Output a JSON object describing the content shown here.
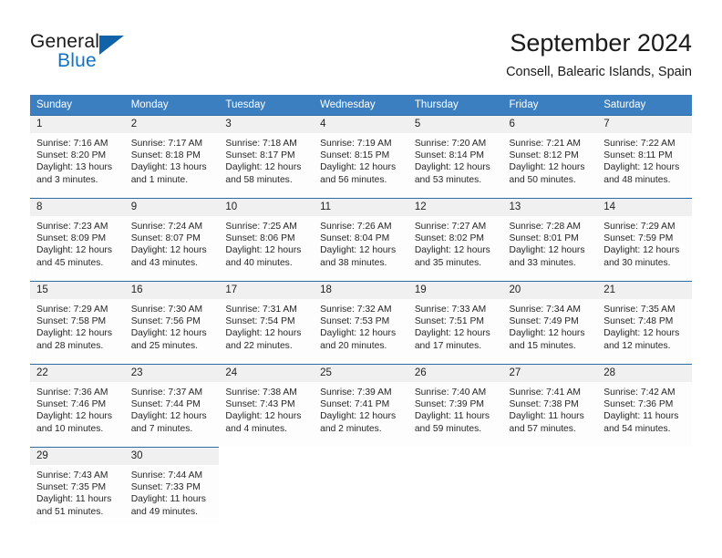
{
  "brand": {
    "name_part1": "General",
    "name_part2": "Blue",
    "accent_color": "#1273c4",
    "triangle_color": "#1063a8"
  },
  "header": {
    "title": "September 2024",
    "subtitle": "Consell, Balearic Islands, Spain"
  },
  "theme": {
    "header_row_bg": "#3c7fc1",
    "row_divider": "#2e6da4",
    "daynum_bg": "#f0f0f0"
  },
  "weekday_headers": [
    "Sunday",
    "Monday",
    "Tuesday",
    "Wednesday",
    "Thursday",
    "Friday",
    "Saturday"
  ],
  "weeks": [
    [
      {
        "day": "1",
        "sunrise": "Sunrise: 7:16 AM",
        "sunset": "Sunset: 8:20 PM",
        "daylight_line1": "Daylight: 13 hours",
        "daylight_line2": "and 3 minutes."
      },
      {
        "day": "2",
        "sunrise": "Sunrise: 7:17 AM",
        "sunset": "Sunset: 8:18 PM",
        "daylight_line1": "Daylight: 13 hours",
        "daylight_line2": "and 1 minute."
      },
      {
        "day": "3",
        "sunrise": "Sunrise: 7:18 AM",
        "sunset": "Sunset: 8:17 PM",
        "daylight_line1": "Daylight: 12 hours",
        "daylight_line2": "and 58 minutes."
      },
      {
        "day": "4",
        "sunrise": "Sunrise: 7:19 AM",
        "sunset": "Sunset: 8:15 PM",
        "daylight_line1": "Daylight: 12 hours",
        "daylight_line2": "and 56 minutes."
      },
      {
        "day": "5",
        "sunrise": "Sunrise: 7:20 AM",
        "sunset": "Sunset: 8:14 PM",
        "daylight_line1": "Daylight: 12 hours",
        "daylight_line2": "and 53 minutes."
      },
      {
        "day": "6",
        "sunrise": "Sunrise: 7:21 AM",
        "sunset": "Sunset: 8:12 PM",
        "daylight_line1": "Daylight: 12 hours",
        "daylight_line2": "and 50 minutes."
      },
      {
        "day": "7",
        "sunrise": "Sunrise: 7:22 AM",
        "sunset": "Sunset: 8:11 PM",
        "daylight_line1": "Daylight: 12 hours",
        "daylight_line2": "and 48 minutes."
      }
    ],
    [
      {
        "day": "8",
        "sunrise": "Sunrise: 7:23 AM",
        "sunset": "Sunset: 8:09 PM",
        "daylight_line1": "Daylight: 12 hours",
        "daylight_line2": "and 45 minutes."
      },
      {
        "day": "9",
        "sunrise": "Sunrise: 7:24 AM",
        "sunset": "Sunset: 8:07 PM",
        "daylight_line1": "Daylight: 12 hours",
        "daylight_line2": "and 43 minutes."
      },
      {
        "day": "10",
        "sunrise": "Sunrise: 7:25 AM",
        "sunset": "Sunset: 8:06 PM",
        "daylight_line1": "Daylight: 12 hours",
        "daylight_line2": "and 40 minutes."
      },
      {
        "day": "11",
        "sunrise": "Sunrise: 7:26 AM",
        "sunset": "Sunset: 8:04 PM",
        "daylight_line1": "Daylight: 12 hours",
        "daylight_line2": "and 38 minutes."
      },
      {
        "day": "12",
        "sunrise": "Sunrise: 7:27 AM",
        "sunset": "Sunset: 8:02 PM",
        "daylight_line1": "Daylight: 12 hours",
        "daylight_line2": "and 35 minutes."
      },
      {
        "day": "13",
        "sunrise": "Sunrise: 7:28 AM",
        "sunset": "Sunset: 8:01 PM",
        "daylight_line1": "Daylight: 12 hours",
        "daylight_line2": "and 33 minutes."
      },
      {
        "day": "14",
        "sunrise": "Sunrise: 7:29 AM",
        "sunset": "Sunset: 7:59 PM",
        "daylight_line1": "Daylight: 12 hours",
        "daylight_line2": "and 30 minutes."
      }
    ],
    [
      {
        "day": "15",
        "sunrise": "Sunrise: 7:29 AM",
        "sunset": "Sunset: 7:58 PM",
        "daylight_line1": "Daylight: 12 hours",
        "daylight_line2": "and 28 minutes."
      },
      {
        "day": "16",
        "sunrise": "Sunrise: 7:30 AM",
        "sunset": "Sunset: 7:56 PM",
        "daylight_line1": "Daylight: 12 hours",
        "daylight_line2": "and 25 minutes."
      },
      {
        "day": "17",
        "sunrise": "Sunrise: 7:31 AM",
        "sunset": "Sunset: 7:54 PM",
        "daylight_line1": "Daylight: 12 hours",
        "daylight_line2": "and 22 minutes."
      },
      {
        "day": "18",
        "sunrise": "Sunrise: 7:32 AM",
        "sunset": "Sunset: 7:53 PM",
        "daylight_line1": "Daylight: 12 hours",
        "daylight_line2": "and 20 minutes."
      },
      {
        "day": "19",
        "sunrise": "Sunrise: 7:33 AM",
        "sunset": "Sunset: 7:51 PM",
        "daylight_line1": "Daylight: 12 hours",
        "daylight_line2": "and 17 minutes."
      },
      {
        "day": "20",
        "sunrise": "Sunrise: 7:34 AM",
        "sunset": "Sunset: 7:49 PM",
        "daylight_line1": "Daylight: 12 hours",
        "daylight_line2": "and 15 minutes."
      },
      {
        "day": "21",
        "sunrise": "Sunrise: 7:35 AM",
        "sunset": "Sunset: 7:48 PM",
        "daylight_line1": "Daylight: 12 hours",
        "daylight_line2": "and 12 minutes."
      }
    ],
    [
      {
        "day": "22",
        "sunrise": "Sunrise: 7:36 AM",
        "sunset": "Sunset: 7:46 PM",
        "daylight_line1": "Daylight: 12 hours",
        "daylight_line2": "and 10 minutes."
      },
      {
        "day": "23",
        "sunrise": "Sunrise: 7:37 AM",
        "sunset": "Sunset: 7:44 PM",
        "daylight_line1": "Daylight: 12 hours",
        "daylight_line2": "and 7 minutes."
      },
      {
        "day": "24",
        "sunrise": "Sunrise: 7:38 AM",
        "sunset": "Sunset: 7:43 PM",
        "daylight_line1": "Daylight: 12 hours",
        "daylight_line2": "and 4 minutes."
      },
      {
        "day": "25",
        "sunrise": "Sunrise: 7:39 AM",
        "sunset": "Sunset: 7:41 PM",
        "daylight_line1": "Daylight: 12 hours",
        "daylight_line2": "and 2 minutes."
      },
      {
        "day": "26",
        "sunrise": "Sunrise: 7:40 AM",
        "sunset": "Sunset: 7:39 PM",
        "daylight_line1": "Daylight: 11 hours",
        "daylight_line2": "and 59 minutes."
      },
      {
        "day": "27",
        "sunrise": "Sunrise: 7:41 AM",
        "sunset": "Sunset: 7:38 PM",
        "daylight_line1": "Daylight: 11 hours",
        "daylight_line2": "and 57 minutes."
      },
      {
        "day": "28",
        "sunrise": "Sunrise: 7:42 AM",
        "sunset": "Sunset: 7:36 PM",
        "daylight_line1": "Daylight: 11 hours",
        "daylight_line2": "and 54 minutes."
      }
    ],
    [
      {
        "day": "29",
        "sunrise": "Sunrise: 7:43 AM",
        "sunset": "Sunset: 7:35 PM",
        "daylight_line1": "Daylight: 11 hours",
        "daylight_line2": "and 51 minutes."
      },
      {
        "day": "30",
        "sunrise": "Sunrise: 7:44 AM",
        "sunset": "Sunset: 7:33 PM",
        "daylight_line1": "Daylight: 11 hours",
        "daylight_line2": "and 49 minutes."
      },
      {
        "day": "",
        "sunrise": "",
        "sunset": "",
        "daylight_line1": "",
        "daylight_line2": ""
      },
      {
        "day": "",
        "sunrise": "",
        "sunset": "",
        "daylight_line1": "",
        "daylight_line2": ""
      },
      {
        "day": "",
        "sunrise": "",
        "sunset": "",
        "daylight_line1": "",
        "daylight_line2": ""
      },
      {
        "day": "",
        "sunrise": "",
        "sunset": "",
        "daylight_line1": "",
        "daylight_line2": ""
      },
      {
        "day": "",
        "sunrise": "",
        "sunset": "",
        "daylight_line1": "",
        "daylight_line2": ""
      }
    ]
  ]
}
